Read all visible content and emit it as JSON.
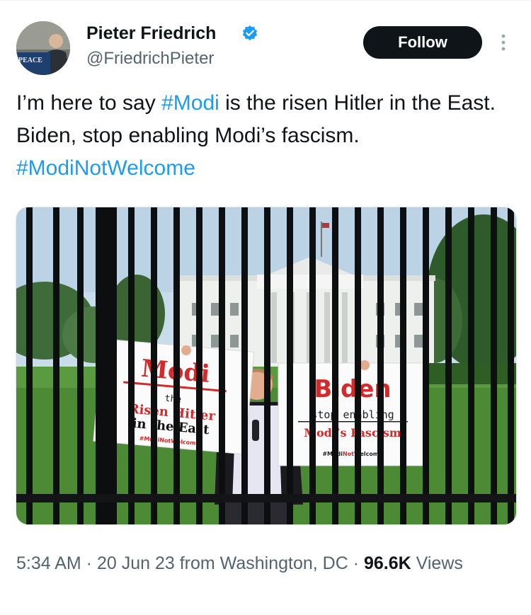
{
  "author": {
    "display_name": "Pieter Friedrich",
    "handle": "@FriedrichPieter",
    "verified": true,
    "avatar_icon": "profile-photo-icon",
    "avatar_sign_text": "PEACE"
  },
  "actions": {
    "follow_label": "Follow",
    "more_icon": "more-vertical-icon"
  },
  "tweet": {
    "text_1": "I’m here to say ",
    "hashtag_1": "#Modi",
    "text_2": " is the risen Hitler in the East. Biden, stop enabling Modi’s fascism. ",
    "hashtag_2": "#ModiNotWelcome"
  },
  "media": {
    "sign_left": {
      "line1": "Modi",
      "line2": "the",
      "line3": "Risen Hitler",
      "line4": "in the East",
      "tag": "#ModiNotWelcome"
    },
    "sign_right": {
      "line1": "Biden",
      "line2": "stop enabling",
      "line3": "Modi’s Fascism",
      "tag_part1": "#Modi",
      "tag_part2": "Not",
      "tag_part3": "Welcome"
    }
  },
  "meta": {
    "time": "5:34 AM",
    "sep1": " · ",
    "date": "20 Jun 23",
    "location": " from Washington, DC",
    "sep2": " · ",
    "views_count": "96.6K",
    "views_label": " Views"
  },
  "colors": {
    "hashtag": "#1d9bf0",
    "verified": "#1d9bf0",
    "sign_red": "#d22b2b",
    "button_bg": "#0f1419"
  }
}
